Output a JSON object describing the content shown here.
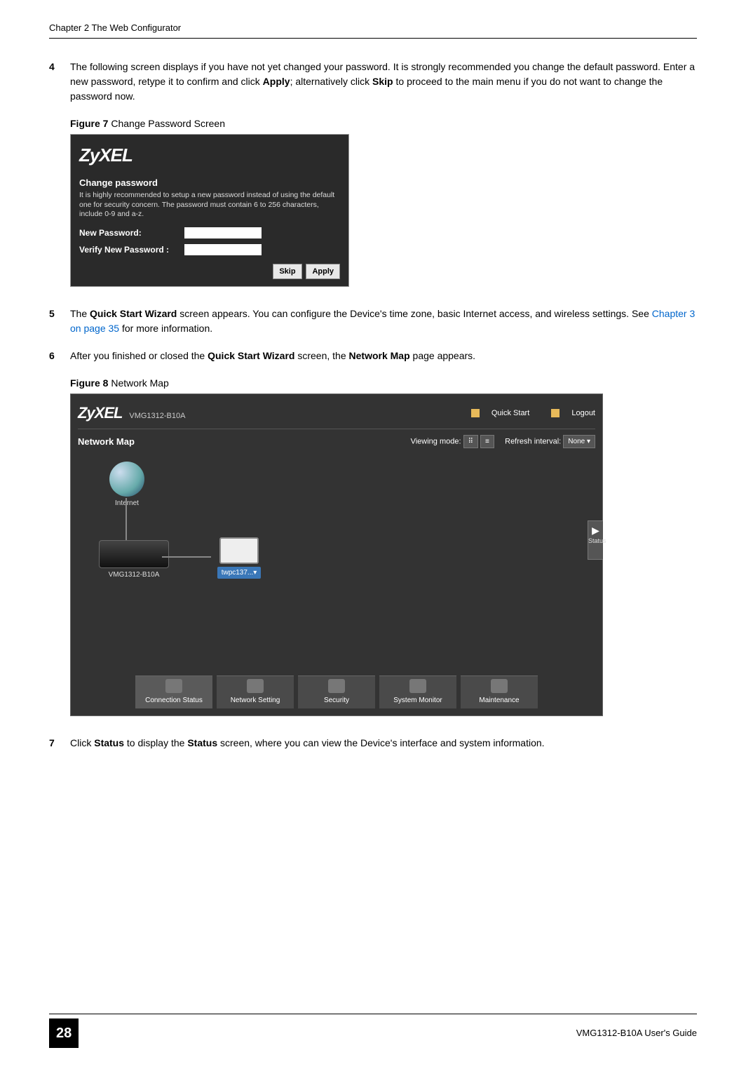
{
  "header": {
    "chapter": "Chapter 2 The Web Configurator"
  },
  "steps": {
    "s4": {
      "num": "4",
      "text_pre": "The following screen displays if you have not yet changed your password. It is strongly recommended you change the default password. Enter a new password, retype it to confirm and click ",
      "bold1": "Apply",
      "text_mid": "; alternatively click ",
      "bold2": "Skip",
      "text_post": " to proceed to the main menu if you do not want to change the password now."
    },
    "s5": {
      "num": "5",
      "pre": "The ",
      "bold1": "Quick Start Wizard",
      "mid1": " screen appears. You can configure the Device's time zone, basic Internet access, and wireless settings. See ",
      "link": "Chapter 3 on page 35",
      "post": " for more information."
    },
    "s6": {
      "num": "6",
      "pre": "After you finished or closed the ",
      "bold1": "Quick Start Wizard",
      "mid": " screen, the ",
      "bold2": "Network Map",
      "post": " page appears."
    },
    "s7": {
      "num": "7",
      "pre": "Click ",
      "bold1": "Status",
      "mid": " to display the ",
      "bold2": "Status",
      "post": " screen, where you can view the Device's interface and system information."
    }
  },
  "fig7": {
    "caption_bold": "Figure 7",
    "caption_rest": "   Change Password Screen",
    "logo": "ZyXEL",
    "title": "Change password",
    "desc": "It is highly recommended to setup a new password instead of using the default one for security concern. The password must contain 6 to 256 characters, include 0-9 and a-z.",
    "new_label": "New Password:",
    "verify_label": "Verify New Password :",
    "skip": "Skip",
    "apply": "Apply"
  },
  "fig8": {
    "caption_bold": "Figure 8",
    "caption_rest": "   Network Map",
    "logo": "ZyXEL",
    "model": "VMG1312-B10A",
    "quick_start": "Quick Start",
    "logout": "Logout",
    "nm_title": "Network Map",
    "viewing_mode": "Viewing mode:",
    "refresh_label": "Refresh interval:",
    "refresh_value": "None",
    "internet": "Internet",
    "router_label": "VMG1312-B10A",
    "client_label": "twpc137...▾",
    "status_tab": "Status",
    "nav": {
      "items": [
        {
          "label": "Connection Status"
        },
        {
          "label": "Network Setting"
        },
        {
          "label": "Security"
        },
        {
          "label": "System Monitor"
        },
        {
          "label": "Maintenance"
        }
      ]
    }
  },
  "footer": {
    "page": "28",
    "guide": "VMG1312-B10A User's Guide"
  }
}
